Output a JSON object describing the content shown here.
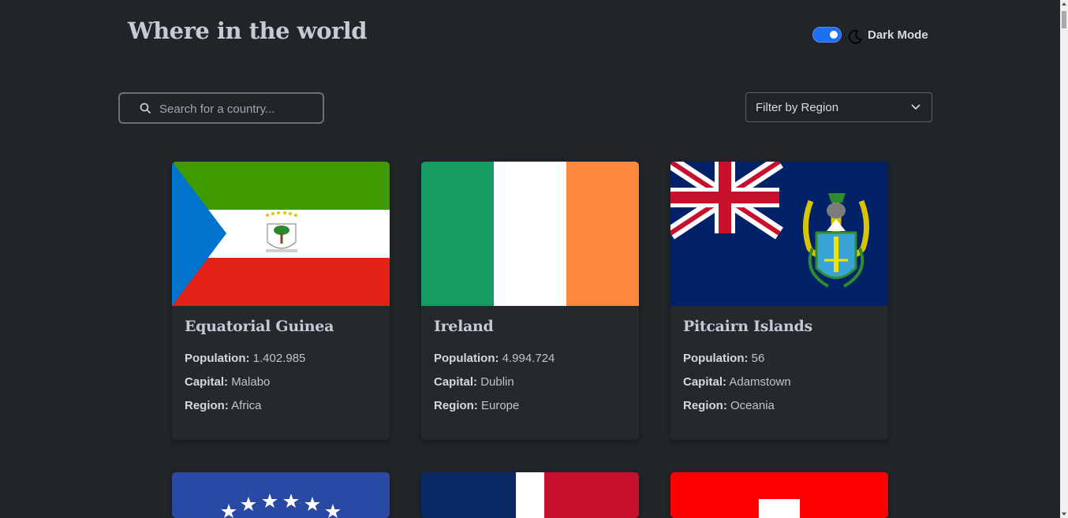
{
  "header": {
    "title": "Where in the world",
    "mode_label": "Dark Mode",
    "toggle_on": true,
    "accent": "#1e6ff0"
  },
  "search": {
    "placeholder": "Search for a country...",
    "value": "",
    "icon": "search-icon"
  },
  "filter": {
    "selected": "Filter by Region",
    "icon": "chevron-down-icon"
  },
  "labels": {
    "population": "Population:",
    "capital": "Capital:",
    "region": "Region:"
  },
  "countries": [
    {
      "name": "Equatorial Guinea",
      "population": "1.402.985",
      "capital": "Malabo",
      "region": "Africa"
    },
    {
      "name": "Ireland",
      "population": "4.994.724",
      "capital": "Dublin",
      "region": "Europe"
    },
    {
      "name": "Pitcairn Islands",
      "population": "56",
      "capital": "Adamstown",
      "region": "Oceania"
    }
  ]
}
